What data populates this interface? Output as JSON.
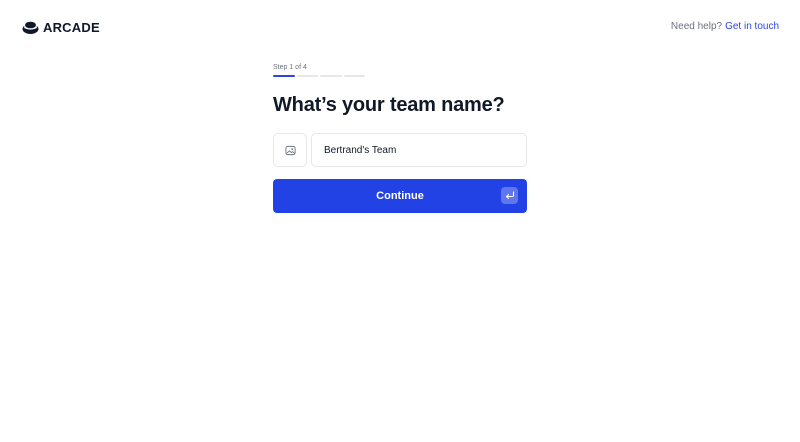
{
  "header": {
    "logo_text": "ARCADE",
    "help_text": "Need help?",
    "help_link": "Get in touch"
  },
  "onboarding": {
    "step_label": "Step 1 of 4",
    "current_step": 1,
    "total_steps": 4,
    "title": "What’s your team name?",
    "team_name_value": "Bertrand's Team",
    "continue_label": "Continue"
  },
  "icons": {
    "logo": "arcade-logo-icon",
    "avatar_picker": "image-icon",
    "enter": "enter-return-icon"
  },
  "colors": {
    "accent": "#2342e6",
    "link": "#2f45e0",
    "muted_text": "#6b7280",
    "border": "#e5e7eb"
  }
}
